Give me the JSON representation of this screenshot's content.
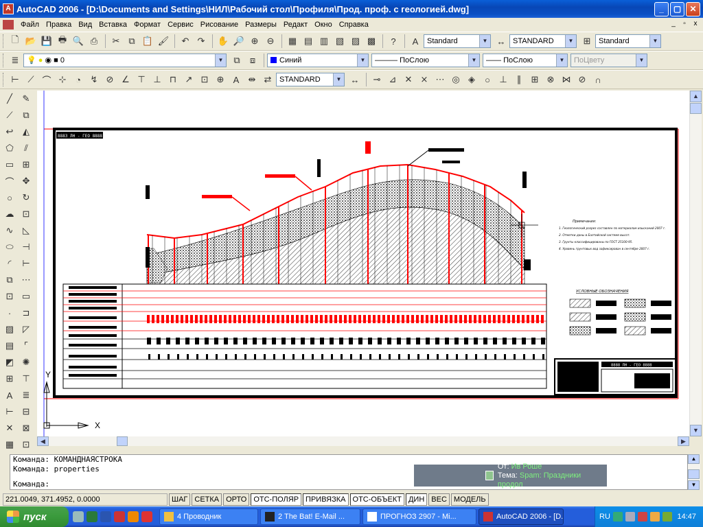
{
  "window": {
    "title": "AutoCAD 2006 - [D:\\Documents and Settings\\НИЛ\\Рабочий стол\\Профиля\\Прод. проф. с геологией.dwg]",
    "app_icon": "A",
    "minimize": "_",
    "maximize": "▢",
    "close": "✕"
  },
  "menu": {
    "items": [
      "Файл",
      "Правка",
      "Вид",
      "Вставка",
      "Формат",
      "Сервис",
      "Рисование",
      "Размеры",
      "Редакт",
      "Окно",
      "Справка"
    ],
    "doc_min": "_",
    "doc_restore": "▫",
    "doc_close": "x"
  },
  "toolbar1": {
    "text_style": "Standard",
    "dim_style": "STANDARD",
    "table_style": "Standard"
  },
  "toolbar2": {
    "layer": "0",
    "color": "Синий",
    "color_hex": "#0000ff",
    "linetype": "ПоСлою",
    "lineweight": "ПоСлою",
    "plotstyle": "ПоЦвету"
  },
  "toolbar3": {
    "dim_style": "STANDARD"
  },
  "drawing": {
    "stamp_tl": "8883 ЛН - ГЕО 8888",
    "stamp_br": "8888 ЛН - ГЕО 8888",
    "legend_title": "УСЛОВНЫЕ ОБОЗНАЧЕНИЯ",
    "notes_title": "Примечания:",
    "notes": [
      "1. Геологический разрез составлен по материалам изысканий 2007 г.",
      "2. Отметки даны в Балтийской системе высот.",
      "3. Грунты классифицированы по ГОСТ 25100-95.",
      "4. Уровень грунтовых вод зафиксирован в сентябре 2007 г."
    ],
    "ucs_x": "X",
    "ucs_y": "Y"
  },
  "command": {
    "history": [
      "Команда: КОМАНДНАЯСТРОКА",
      "Команда: properties"
    ],
    "prompt": "Команда:"
  },
  "popup": {
    "from_label": "От:",
    "from_value": "Ив Роше",
    "subject_label": "Тема:",
    "subject_value": "Spam: Праздники продол"
  },
  "status": {
    "coords": "221.0049, 371.4952, 0.0000",
    "buttons": [
      "ШАГ",
      "СЕТКА",
      "ОРТО",
      "ОТС-ПОЛЯР",
      "ПРИВЯЗКА",
      "ОТС-ОБЪЕКТ",
      "ДИН",
      "ВЕС",
      "МОДЕЛЬ"
    ]
  },
  "taskbar": {
    "start": "пуск",
    "tasks": [
      "4 Проводник",
      "2 The Bat! E-Mail ...",
      "ПРОГНОЗ 2907 - Mi...",
      "AutoCAD 2006 - [D..."
    ],
    "lang": "RU",
    "clock": "14:47"
  },
  "colors": {
    "accent_red": "#ff0000",
    "titlebar_blue": "#0a4fc4",
    "taskbar_blue": "#245edb"
  }
}
